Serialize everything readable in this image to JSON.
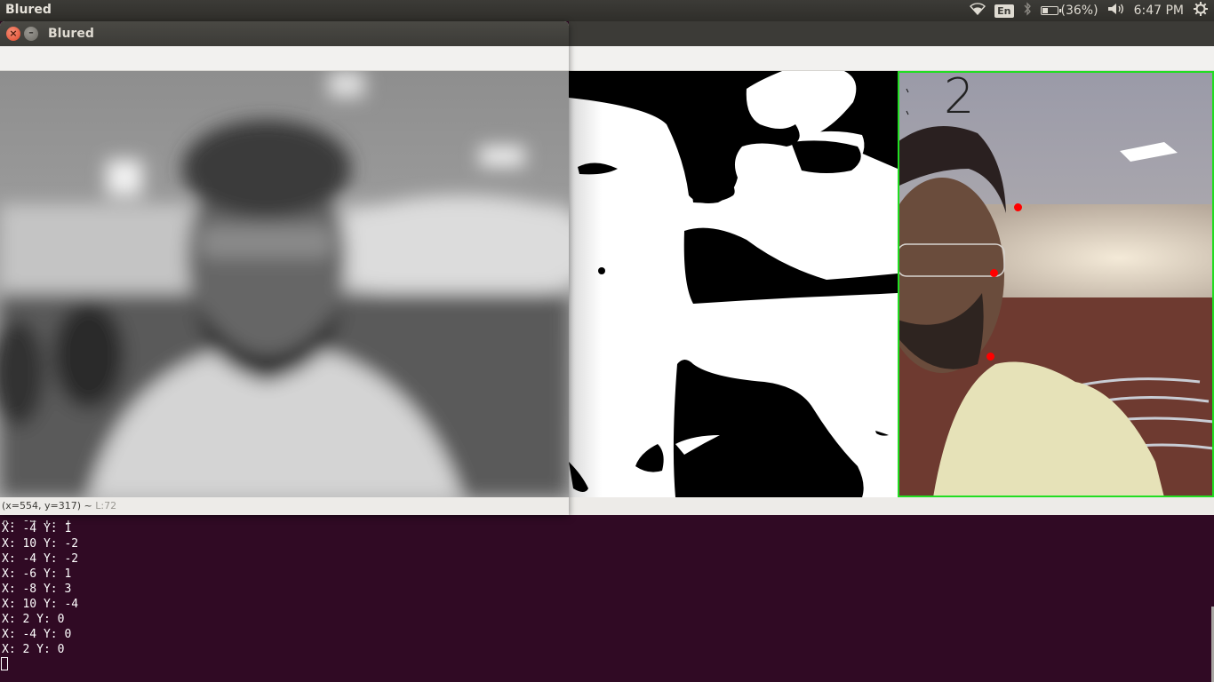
{
  "topbar": {
    "app_title": "Blured",
    "keyboard_layout": "En",
    "battery_text": "(36%)",
    "battery_level": 0.36,
    "clock": "6:47 PM"
  },
  "icons": [
    "wifi-icon",
    "bluetooth-icon",
    "battery-icon",
    "volume-icon",
    "gear-icon",
    "close-icon",
    "minimize-icon"
  ],
  "windows": {
    "blured": {
      "title": "Blured",
      "status_coords": "(x=554, y=317) ~",
      "status_level": "L:72"
    },
    "tracking": {
      "counter_label": "2",
      "frame_color": "#22dd22",
      "marker_color": "#ff0000"
    }
  },
  "terminal": {
    "lines": [
      "X: -4 Y: 1",
      "X: 10 Y: -2",
      "X: -4 Y: -2",
      "X: -6 Y: 1",
      "X: -8 Y: 3",
      "X: 10 Y: -4",
      "X: 2 Y: 0",
      "X: -4 Y: 0",
      "X: 2 Y: 0"
    ],
    "background": "#300a24"
  }
}
